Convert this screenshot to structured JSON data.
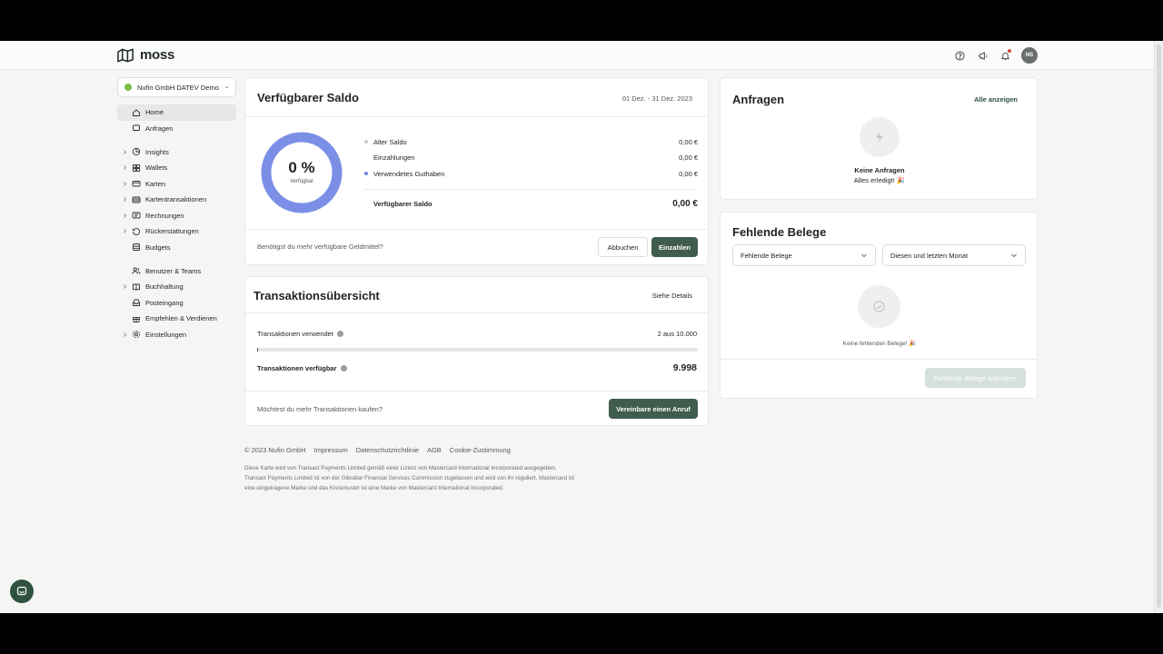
{
  "brand": {
    "name": "moss"
  },
  "header": {
    "avatar_initials": "NS"
  },
  "org": {
    "name": "Nufin GmbH DATEV Demo"
  },
  "sidebar": {
    "items": [
      {
        "label": "Home",
        "icon": "home-icon",
        "expandable": false,
        "active": true
      },
      {
        "label": "Anfragen",
        "icon": "chat-icon",
        "expandable": false
      },
      {
        "label": "Insights",
        "icon": "pie-icon",
        "expandable": true
      },
      {
        "label": "Wallets",
        "icon": "grid-icon",
        "expandable": true
      },
      {
        "label": "Karten",
        "icon": "card-icon",
        "expandable": true
      },
      {
        "label": "Kartentransaktionen",
        "icon": "list-icon",
        "expandable": true
      },
      {
        "label": "Rechnungen",
        "icon": "invoice-icon",
        "expandable": true
      },
      {
        "label": "Rückerstattungen",
        "icon": "refund-icon",
        "expandable": true
      },
      {
        "label": "Budgets",
        "icon": "budget-icon",
        "expandable": false
      },
      {
        "label": "Benutzer & Teams",
        "icon": "users-icon",
        "expandable": false
      },
      {
        "label": "Buchhaltung",
        "icon": "book-icon",
        "expandable": true
      },
      {
        "label": "Posteingang",
        "icon": "inbox-icon",
        "expandable": false
      },
      {
        "label": "Empfehlen & Verdienen",
        "icon": "gift-icon",
        "expandable": false
      },
      {
        "label": "Einstellungen",
        "icon": "gear-icon",
        "expandable": true
      }
    ]
  },
  "saldo": {
    "title": "Verfügbarer Saldo",
    "date_range": "01 Dez. - 31 Dez. 2023",
    "percent": "0 %",
    "percent_label": "Verfügbar",
    "rows": [
      {
        "label": "Alter Saldo",
        "value": "0,00 €",
        "bullet": "#c9cbc9"
      },
      {
        "label": "Einzahlungen",
        "value": "0,00 €",
        "bullet": ""
      },
      {
        "label": "Verwendetes Guthaben",
        "value": "0,00 €",
        "bullet": "#6f86e0"
      }
    ],
    "total_label": "Verfügbarer Saldo",
    "total_value": "0,00 €",
    "footer_question": "Benötigst du mehr verfügbare Geldmittel?",
    "cancel_label": "Abbuchen",
    "deposit_label": "Einzahlen"
  },
  "transactions": {
    "title": "Transaktionsübersicht",
    "details_link": "Siehe Details",
    "used_label": "Transaktionen verwendet",
    "used_value": "2 aus 10.000",
    "used_fraction": 0.0002,
    "available_label": "Transaktionen verfügbar",
    "available_value": "9.998",
    "footer_question": "Möchtest du mehr Transaktionen kaufen?",
    "call_label": "Vereinbare einen Anruf"
  },
  "requests": {
    "title": "Anfragen",
    "show_all": "Alle anzeigen",
    "empty_title": "Keine Anfragen",
    "empty_sub": "Alles erledigt! 🎉"
  },
  "missing": {
    "title": "Fehlende Belege",
    "filter1": "Fehlende Belege",
    "filter2": "Diesen und letzten Monat",
    "empty_text": "Keine fehlenden Belege! 🎉",
    "request_label": "Fehlende Belege anfordern"
  },
  "footer": {
    "links": [
      "© 2023 Nufin GmbH",
      "Impressum",
      "Datenschutzrichtlinie",
      "AGB",
      "Cookie-Zustimmung"
    ],
    "legal": "Diese Karte wird von Transact Payments Limited gemäß einer Lizenz von Mastercard International Incorporated ausgegeben. Transact Payments Limited ist von der Gibraltar Financial Services Commission zugelassen und wird von ihr reguliert. Mastercard ist eine eingetragene Marke und das Kreismuster ist eine Marke von Mastercard International Incorporated."
  },
  "colors": {
    "accent": "#3f5c4c",
    "donut": "#7b8fe6",
    "brand_green": "#7bbf45"
  }
}
